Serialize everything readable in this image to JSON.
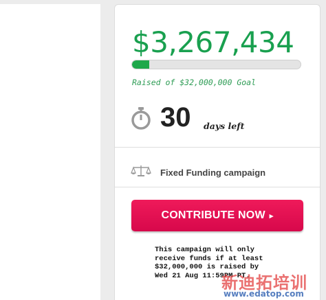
{
  "campaign": {
    "amount_raised": "$3,267,434",
    "progress_fraction": 0.102,
    "goal_text": "Raised of $32,000,000 Goal",
    "days_number": "30",
    "days_label": "days left",
    "funding_type": "Fixed Funding campaign",
    "contribute_label": "CONTRIBUTE NOW",
    "contribute_arrow": "▸",
    "note_lines": [
      "This campaign will only",
      "receive funds if at least",
      "$32,000,000 is raised by",
      "Wed 21 Aug 11:59PM PT."
    ]
  },
  "icons": {
    "timer": "stopwatch-icon",
    "funding": "balance-scale-icon"
  },
  "watermark": {
    "chinese": "新迪拓培训",
    "url": "www.edatop.com"
  },
  "colors": {
    "accent_green": "#19a04f",
    "button_pink": "#e0114f",
    "background": "#ececec"
  }
}
